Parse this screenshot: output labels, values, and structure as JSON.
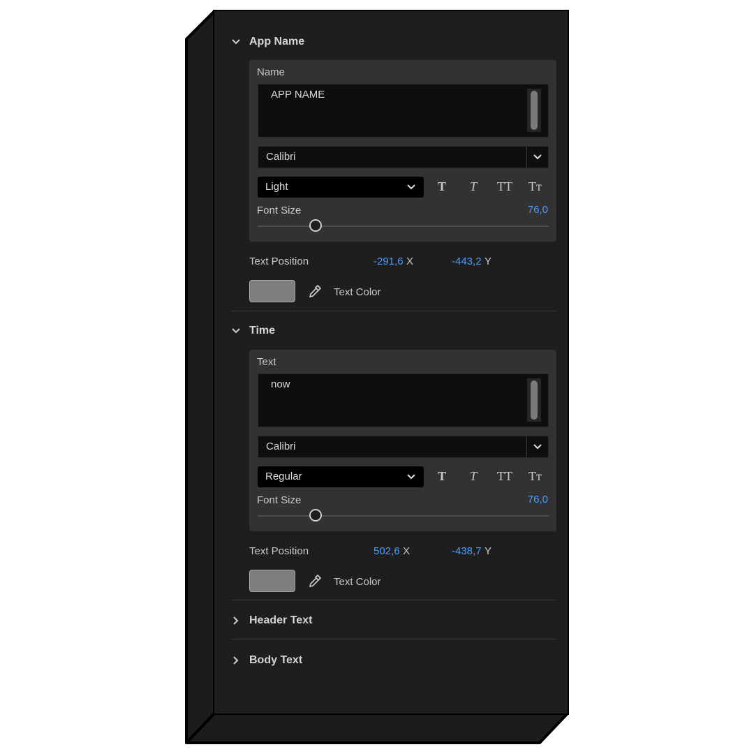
{
  "sections": {
    "app_name": {
      "title": "App Name",
      "field_label": "Name",
      "field_value": "APP NAME",
      "font": "Calibri",
      "style": "Light",
      "font_size_label": "Font Size",
      "font_size_value": "76,0",
      "font_size_slider_fraction": 0.2,
      "position_label": "Text Position",
      "pos_x": "-291,6",
      "pos_x_axis": "X",
      "pos_y": "-443,2",
      "pos_y_axis": "Y",
      "color_label": "Text Color",
      "color": "#7e7e7e"
    },
    "time": {
      "title": "Time",
      "field_label": "Text",
      "field_value": "now",
      "font": "Calibri",
      "style": "Regular",
      "font_size_label": "Font Size",
      "font_size_value": "76,0",
      "font_size_slider_fraction": 0.2,
      "position_label": "Text Position",
      "pos_x": "502,6",
      "pos_x_axis": "X",
      "pos_y": "-438,7",
      "pos_y_axis": "Y",
      "color_label": "Text Color",
      "color": "#7e7e7e"
    },
    "header_text": {
      "title": "Header Text"
    },
    "body_text": {
      "title": "Body Text"
    }
  },
  "text_style_buttons": [
    "T",
    "T",
    "TT",
    "Tт"
  ],
  "icons": {
    "expanded": "chevron-down-icon",
    "collapsed": "chevron-right-icon",
    "dropdown": "chevron-down-icon",
    "eyedropper": "eyedropper-icon"
  },
  "colors": {
    "panel_bg": "#1e1e1e",
    "group_bg": "#323232",
    "accent_value": "#4a9eff"
  }
}
